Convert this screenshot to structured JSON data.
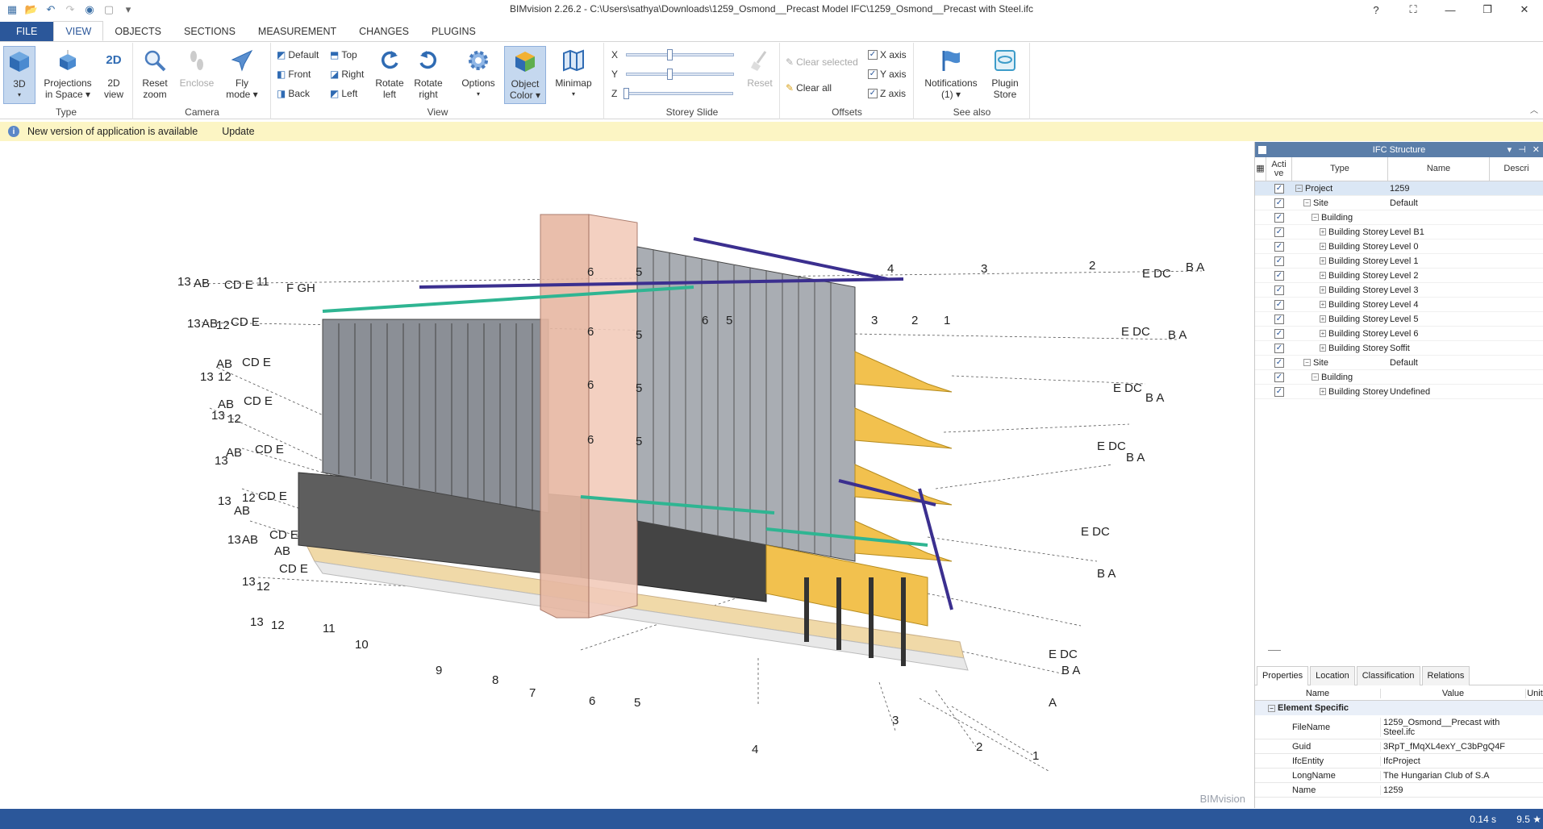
{
  "window": {
    "title": "BIMvision 2.26.2 - C:\\Users\\sathya\\Downloads\\1259_Osmond__Precast Model IFC\\1259_Osmond__Precast with Steel.ifc",
    "help": "?",
    "minimize": "—",
    "restore": "❐",
    "close": "✕"
  },
  "tabs": [
    "FILE",
    "VIEW",
    "OBJECTS",
    "SECTIONS",
    "MEASUREMENT",
    "CHANGES",
    "PLUGINS"
  ],
  "ribbon": {
    "type": {
      "label": "Type",
      "btn_3d": "3D",
      "btn_proj_1": "Projections",
      "btn_proj_2": "in Space",
      "btn_2d_1": "2D",
      "btn_2d_2": "view"
    },
    "camera": {
      "label": "Camera",
      "reset_1": "Reset",
      "reset_2": "zoom",
      "enclose": "Enclose",
      "fly_1": "Fly",
      "fly_2": "mode"
    },
    "view": {
      "label": "View",
      "default": "Default",
      "front": "Front",
      "back": "Back",
      "top": "Top",
      "right": "Right",
      "left": "Left",
      "rot_left_1": "Rotate",
      "rot_left_2": "left",
      "rot_right_1": "Rotate",
      "rot_right_2": "right",
      "options": "Options",
      "objcolor_1": "Object",
      "objcolor_2": "Color",
      "minimap": "Minimap"
    },
    "storey": {
      "label": "Storey Slide",
      "x": "X",
      "y": "Y",
      "z": "Z",
      "reset": "Reset",
      "x_level": 0.4,
      "y_level": 0.4,
      "z_level": 0.0
    },
    "offsets": {
      "label": "Offsets",
      "clear_selected": "Clear selected",
      "clear_all": "Clear all",
      "x_axis": "X axis",
      "y_axis": "Y axis",
      "z_axis": "Z axis"
    },
    "seealso": {
      "label": "See also",
      "notif_1": "Notifications",
      "notif_2": "(1)",
      "plugin_1": "Plugin",
      "plugin_2": "Store"
    }
  },
  "notification": {
    "text": "New version of application is available",
    "action": "Update"
  },
  "viewport": {
    "watermark": "BIMvision"
  },
  "ifc": {
    "title": "IFC Structure",
    "col_active": "Acti ve",
    "col_type": "Type",
    "col_name": "Name",
    "col_desc": "Descri",
    "rows": [
      {
        "type": "Project",
        "name": "1259"
      },
      {
        "type": "Site",
        "name": "Default"
      },
      {
        "type": "Building",
        "name": ""
      },
      {
        "type": "Building Storey",
        "name": "Level B1"
      },
      {
        "type": "Building Storey",
        "name": "Level 0"
      },
      {
        "type": "Building Storey",
        "name": "Level 1"
      },
      {
        "type": "Building Storey",
        "name": "Level 2"
      },
      {
        "type": "Building Storey",
        "name": "Level 3"
      },
      {
        "type": "Building Storey",
        "name": "Level 4"
      },
      {
        "type": "Building Storey",
        "name": "Level 5"
      },
      {
        "type": "Building Storey",
        "name": "Level 6"
      },
      {
        "type": "Building Storey",
        "name": "Soffit"
      },
      {
        "type": "Site",
        "name": "Default"
      },
      {
        "type": "Building",
        "name": ""
      },
      {
        "type": "Building Storey",
        "name": "Undefined"
      }
    ]
  },
  "props": {
    "tabs": [
      "Properties",
      "Location",
      "Classification",
      "Relations"
    ],
    "col_name": "Name",
    "col_value": "Value",
    "col_unit": "Unit",
    "group": "Element Specific",
    "rows": [
      {
        "k": "FileName",
        "v": "1259_Osmond__Precast with Steel.ifc"
      },
      {
        "k": "Guid",
        "v": "3RpT_fMqXL4exY_C3bPgQ4F"
      },
      {
        "k": "IfcEntity",
        "v": "IfcProject"
      },
      {
        "k": "LongName",
        "v": "The Hungarian Club of S.A"
      },
      {
        "k": "Name",
        "v": "1259"
      }
    ]
  },
  "status": {
    "time": "0.14 s",
    "version": "9.5 ★"
  },
  "colors": {
    "brand": "#2b579a",
    "panel_header": "#5b7ea9",
    "notify_bg": "#fcf5c4"
  }
}
